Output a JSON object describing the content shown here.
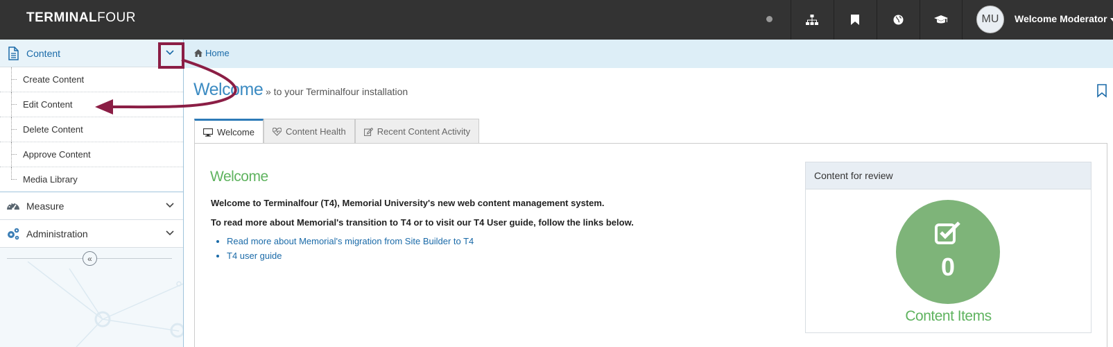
{
  "app": {
    "logo_bold": "TERMINAL",
    "logo_light": "FOUR",
    "user_initials": "MU",
    "user_greeting": "Welcome Moderator"
  },
  "icons": {
    "top_buttons": [
      "sitemap-icon",
      "bookmark-icon",
      "globe-icon",
      "graduation-cap-icon"
    ]
  },
  "sidebar": {
    "sections": [
      {
        "label": "Content",
        "icon": "document-icon",
        "expanded": true
      },
      {
        "label": "Measure",
        "icon": "dashboard-icon",
        "expanded": false
      },
      {
        "label": "Administration",
        "icon": "gears-icon",
        "expanded": false
      }
    ],
    "content_items": [
      "Create Content",
      "Edit Content",
      "Delete Content",
      "Approve Content",
      "Media Library"
    ],
    "collapse_symbol": "«"
  },
  "breadcrumb": {
    "home": "Home"
  },
  "page": {
    "title": "Welcome",
    "subtitle": "» to your Terminalfour installation"
  },
  "tabs": [
    {
      "label": "Welcome",
      "icon": "monitor-icon",
      "active": true
    },
    {
      "label": "Content Health",
      "icon": "heartbeat-icon",
      "active": false
    },
    {
      "label": "Recent Content Activity",
      "icon": "edit-icon",
      "active": false
    }
  ],
  "welcome": {
    "heading": "Welcome",
    "line1": "Welcome to Terminalfour (T4), Memorial University's new web content management system.",
    "line2": "To read more about Memorial's transition to T4 or to visit our T4 User guide, follow the links below.",
    "links": [
      "Read more about Memorial's migration from Site Builder to T4",
      "T4 user guide"
    ]
  },
  "review": {
    "title": "Content for review",
    "count": "0",
    "label": "Content Items"
  },
  "colors": {
    "topbar": "#333333",
    "accent_blue": "#1a6aa8",
    "green": "#5fb35f",
    "circle_green": "#7eb479",
    "highlight": "#8b1e45"
  }
}
